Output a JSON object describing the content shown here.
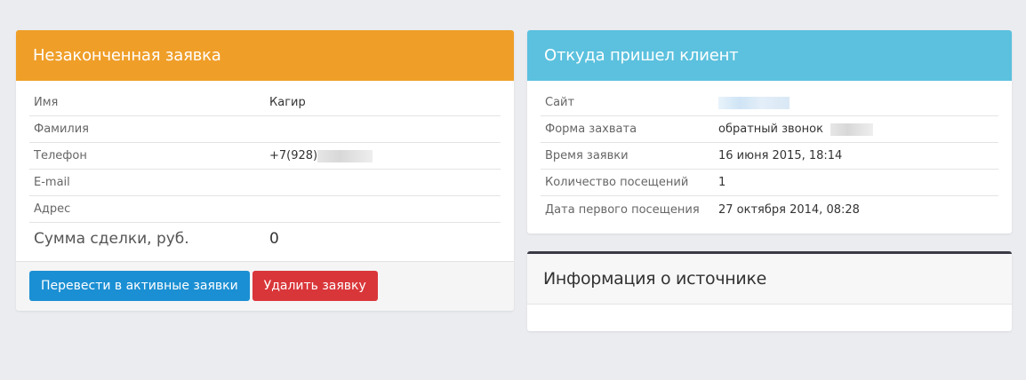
{
  "incomplete": {
    "title": "Незаконченная заявка",
    "rows": [
      {
        "label": "Имя",
        "value": "Кагир"
      },
      {
        "label": "Фамилия",
        "value": ""
      },
      {
        "label": "Телефон",
        "value": "+7(928)"
      },
      {
        "label": "E-mail",
        "value": ""
      },
      {
        "label": "Адрес",
        "value": ""
      }
    ],
    "sum_label": "Сумма сделки, руб.",
    "sum_value": "0",
    "activate_button": "Перевести в активные заявки",
    "delete_button": "Удалить заявку"
  },
  "source_client": {
    "title": "Откуда пришел клиент",
    "rows": [
      {
        "label": "Сайт",
        "value": ""
      },
      {
        "label": "Форма захвата",
        "value": "обратный звонок"
      },
      {
        "label": "Время заявки",
        "value": "16 июня 2015, 18:14"
      },
      {
        "label": "Количество посещений",
        "value": "1"
      },
      {
        "label": "Дата первого посещения",
        "value": "27 октября 2014, 08:28"
      }
    ]
  },
  "source_info": {
    "title": "Информация о источнике"
  },
  "colors": {
    "orange_header": "#ef9e28",
    "blue_header": "#5bc1de",
    "primary_button": "#1b8fd3",
    "danger_button": "#d9363a",
    "dark_border": "#3a3b44"
  }
}
